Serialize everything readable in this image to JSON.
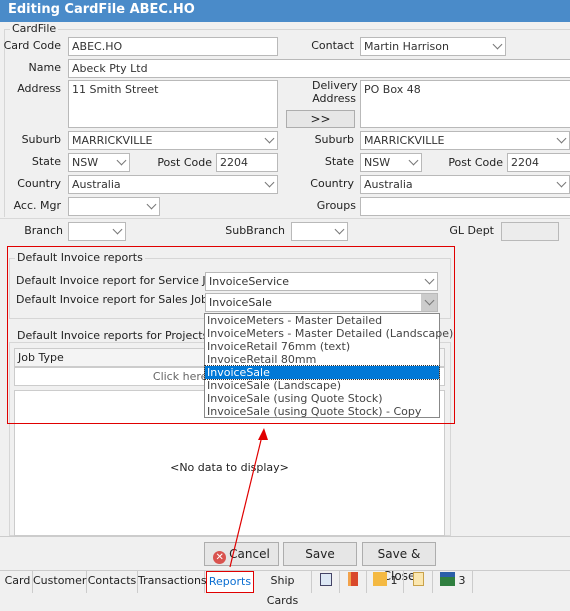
{
  "window": {
    "title": "Editing CardFile ABEC.HO"
  },
  "cardfile": {
    "group_title": "CardFile",
    "card_code_label": "Card Code",
    "card_code": "ABEC.HO",
    "contact_label": "Contact",
    "contact": "Martin Harrison",
    "name_label": "Name",
    "name": "Abeck Pty Ltd",
    "address_label": "Address",
    "address": "11 Smith Street",
    "delivery_label": "Delivery Address",
    "delivery": "PO Box 48",
    "copy_button": ">>",
    "suburb_label": "Suburb",
    "suburb": "MARRICKVILLE",
    "delivery_suburb": "MARRICKVILLE",
    "state_label": "State",
    "state": "NSW",
    "delivery_state": "NSW",
    "postcode_label": "Post Code",
    "postcode": "2204",
    "delivery_postcode": "2204",
    "country_label": "Country",
    "country": "Australia",
    "delivery_country": "Australia",
    "acc_mgr_label": "Acc. Mgr",
    "acc_mgr": "",
    "groups_label": "Groups",
    "groups": "",
    "branch_label": "Branch",
    "subbranch_label": "SubBranch",
    "gl_dept_label": "GL Dept"
  },
  "invoice": {
    "group_title": "Default Invoice reports",
    "service_label": "Default Invoice report for Service Job",
    "service_value": "InvoiceService",
    "sales_label": "Default Invoice report for Sales Job",
    "sales_value": "InvoiceSale",
    "options": [
      "InvoiceMeters - Master Detailed",
      "InvoiceMeters - Master Detailed (Landscape)",
      "InvoiceRetail 76mm (text)",
      "InvoiceRetail 80mm",
      "InvoiceSale",
      "InvoiceSale (Landscape)",
      "InvoiceSale (using Quote Stock)",
      "InvoiceSale (using Quote Stock) - Copy"
    ],
    "selected_index": 4
  },
  "projects": {
    "group_title": "Default Invoice reports for Projects",
    "col_job_type": "Job Type",
    "click_here": "Click here to add a new row",
    "empty": "<No data to display>"
  },
  "buttons": {
    "cancel": "Cancel",
    "save": "Save",
    "save_close": "Save & Close"
  },
  "tabs": {
    "card": "Card",
    "customer": "Customer",
    "contacts": "Contacts",
    "transactions": "Transactions",
    "reports": "Reports",
    "ship_cards": "Ship Cards",
    "attachments_count": "1",
    "gifts_count": "3"
  },
  "colors": {
    "title_bar": "#4a8bc9",
    "highlight": "#e00000",
    "selection": "#0078d7",
    "active_tab_text": "#0a6ed1"
  }
}
